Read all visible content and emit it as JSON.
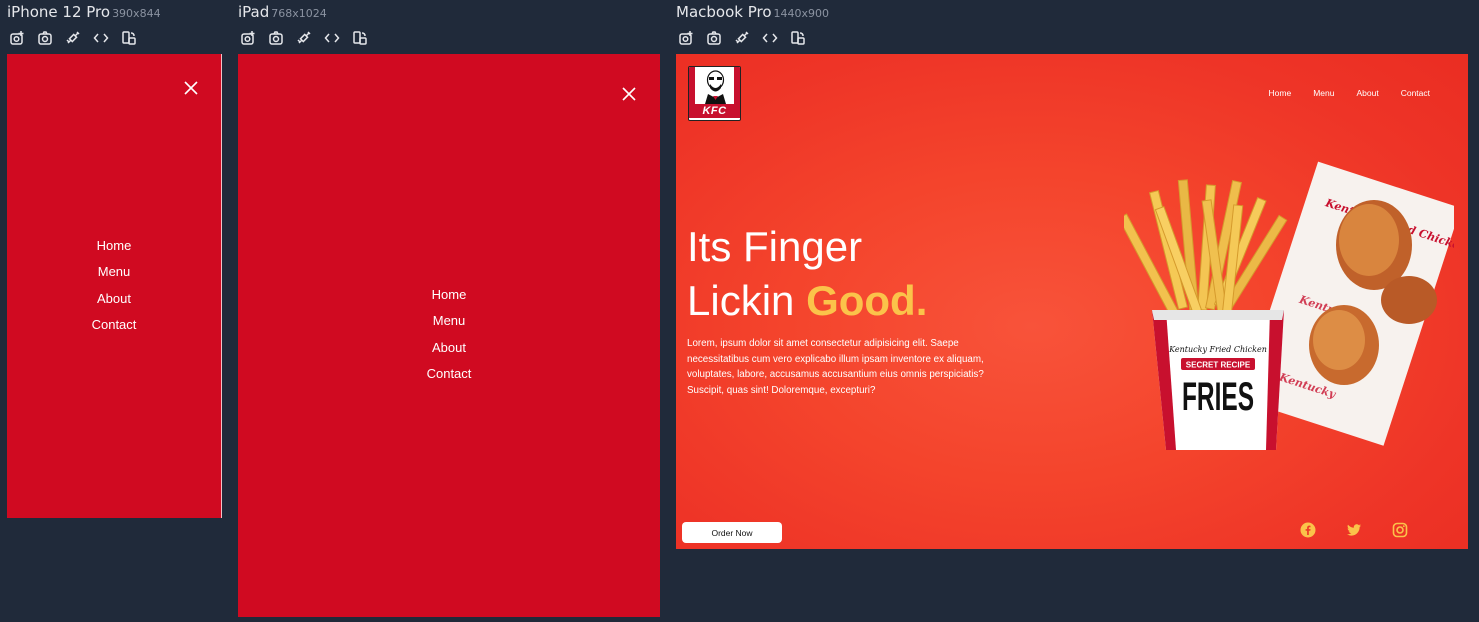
{
  "devices": {
    "iphone": {
      "name": "iPhone 12 Pro",
      "size": "390x844"
    },
    "ipad": {
      "name": "iPad",
      "size": "768x1024"
    },
    "mac": {
      "name": "Macbook Pro",
      "size": "1440x900"
    }
  },
  "toolbar_icons": [
    "screenshot-icon",
    "camera-icon",
    "sync-icon",
    "code-icon",
    "rotate-icon"
  ],
  "mobile_menu": [
    "Home",
    "Menu",
    "About",
    "Contact"
  ],
  "site": {
    "logo_text": "KFC",
    "nav": [
      "Home",
      "Menu",
      "About",
      "Contact"
    ],
    "headline_line1": "Its Finger",
    "headline_line2_plain": "Lickin ",
    "headline_line2_accent": "Good.",
    "paragraph": "Lorem, ipsum dolor sit amet consectetur adipisicing elit. Saepe necessitatibus cum vero explicabo illum ipsam inventore ex aliquam, voluptates, labore, accusamus accusantium eius omnis perspiciatis? Suscipit, quas sint! Doloremque, excepturi?",
    "order_button": "Order Now",
    "product_brand": "Kentucky Fried Chicken",
    "product_badge": "SECRET RECIPE",
    "product_name": "FRIES",
    "wrapper_text": "Kentucky Fried Chicken",
    "socials": [
      "facebook-icon",
      "twitter-icon",
      "instagram-icon"
    ]
  },
  "colors": {
    "page_bg": "#202a3a",
    "menu_red": "#d00a21",
    "hero_red": "#f4442c",
    "accent_gold": "#fbc34a",
    "social_gold": "#fbc34a"
  }
}
